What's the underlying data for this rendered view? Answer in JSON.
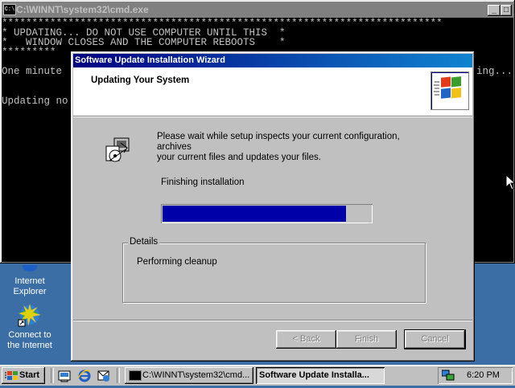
{
  "desktop": {
    "icons": [
      {
        "label_line1": "Internet",
        "label_line2": "Explorer"
      },
      {
        "label_line1": "Connect to",
        "label_line2": "the Internet"
      }
    ]
  },
  "cmd": {
    "title": "C:\\WINNT\\system32\\cmd.exe",
    "lines": [
      "*************************************************************************",
      "* UPDATING... DO NOT USE COMPUTER UNTIL THIS  *",
      "*   WINDOW CLOSES AND THE COMPUTER REBOOTS    *",
      "*********",
      "",
      "One minute",
      "",
      "",
      "Updating no"
    ],
    "right_fragment": "ing..."
  },
  "wizard": {
    "title": "Software Update Installation Wizard",
    "header_title": "Updating Your System",
    "message_line1": "Please wait while setup inspects your current configuration, archives",
    "message_line2": "your current files and updates your files.",
    "status": "Finishing installation",
    "progress": 0.88,
    "details_label": "Details",
    "details_text": "Performing cleanup",
    "buttons": {
      "back": "< Back",
      "finish": "Finish",
      "cancel": "Cancel"
    }
  },
  "taskbar": {
    "start_label": "Start",
    "tasks": [
      {
        "label": "C:\\WINNT\\system32\\cmd...",
        "active": false
      },
      {
        "label": "Software Update Installa...",
        "active": true
      }
    ],
    "clock": "6:20 PM"
  },
  "colors": {
    "desktop": "#3a6ea5",
    "titlebar_active_start": "#000080",
    "titlebar_active_end": "#1084d0",
    "progress_fill": "#0000a8"
  }
}
